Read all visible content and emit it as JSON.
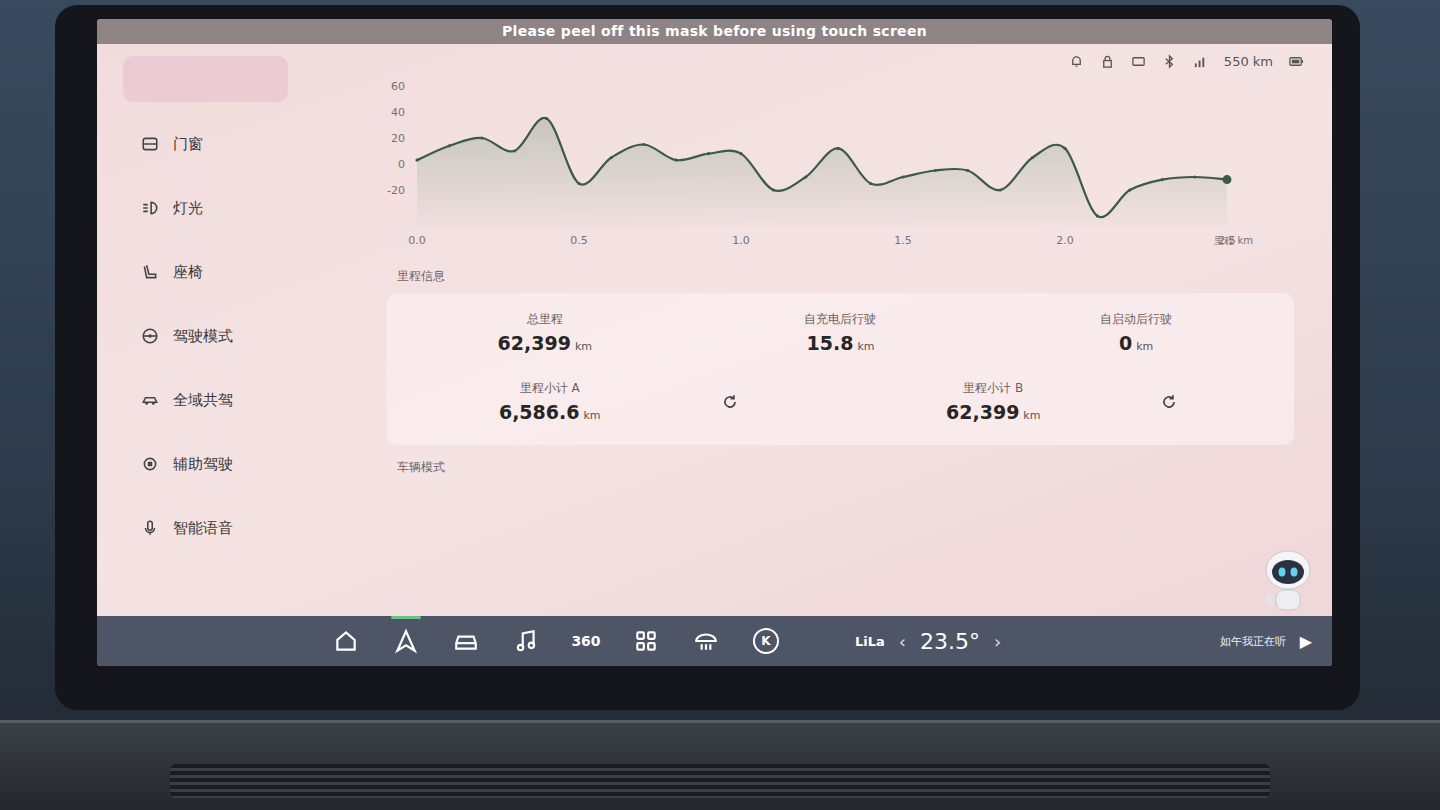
{
  "mask_note": "Please peel off this mask before using touch screen",
  "sidebar": {
    "items": [
      {
        "label": "门窗",
        "selected": false
      },
      {
        "label": "灯光",
        "selected": false
      },
      {
        "label": "座椅",
        "selected": false
      },
      {
        "label": "驾驶模式",
        "selected": false
      },
      {
        "label": "全域共驾",
        "selected": false
      },
      {
        "label": "辅助驾驶",
        "selected": false
      },
      {
        "label": "智能语音",
        "selected": false
      }
    ]
  },
  "status_bar": {
    "range": "550 km"
  },
  "chart": {
    "y_ticks": [
      "60",
      "40",
      "20",
      "0",
      "-20"
    ],
    "x_ticks": [
      "0.0",
      "0.5",
      "1.0",
      "1.5",
      "2.0",
      "2.5"
    ],
    "x_unit": "里程 km",
    "series": [
      {
        "values": [
          3,
          14,
          20,
          10,
          35,
          -15,
          5,
          15,
          3,
          8,
          8,
          -20,
          -10,
          12,
          -15,
          -10,
          -5,
          -5,
          -20,
          5,
          12,
          -40,
          -20,
          -12,
          -10,
          -12
        ]
      }
    ]
  },
  "section_title": "里程信息",
  "stats": [
    {
      "label": "总里程",
      "value": "62,399",
      "unit": "km",
      "resettable": false
    },
    {
      "label": "自充电后行驶",
      "value": "15.8",
      "unit": "km",
      "resettable": false
    },
    {
      "label": "自启动后行驶",
      "value": "0",
      "unit": "km",
      "resettable": false
    },
    {
      "label": "里程小计 A",
      "value": "6,586.6",
      "unit": "km",
      "resettable": true
    },
    {
      "label": "里程小计 B",
      "value": "62,399",
      "unit": "km",
      "resettable": true
    }
  ],
  "next_section": "车辆模式",
  "dock": {
    "apps": [
      {
        "kind": "icon",
        "selected": false
      },
      {
        "kind": "icon",
        "selected": true
      },
      {
        "kind": "icon",
        "selected": false
      },
      {
        "kind": "icon",
        "selected": false
      },
      {
        "kind": "text",
        "label": "360",
        "selected": false
      },
      {
        "kind": "icon",
        "selected": false
      },
      {
        "kind": "icon",
        "selected": false
      },
      {
        "kind": "badge",
        "label": "K",
        "selected": false
      }
    ]
  },
  "climate": {
    "profile": "LiLa",
    "decrease": "‹",
    "temperature": "23.5°",
    "increase": "›"
  },
  "media": {
    "title": "如午我正在听",
    "play": "▶"
  }
}
